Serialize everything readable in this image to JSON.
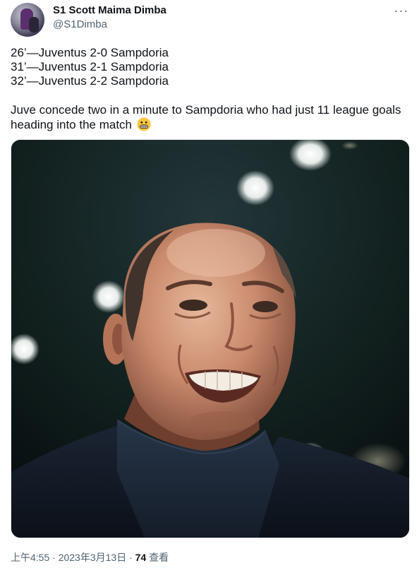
{
  "author": {
    "display_name": "S1 Scott Maima Dimba",
    "handle": "@S1Dimba",
    "avatar_icon": "avatar-photo"
  },
  "more_icon": "more-horizontal-icon",
  "tweet": {
    "lines": [
      "26’—Juventus 2-0 Sampdoria",
      "31’—Juventus 2-1 Sampdoria",
      "32’—Juventus 2-2 Sampdoria"
    ],
    "caption": "Juve concede two in a minute to Sampdoria who had just 11 league goals heading into the match",
    "emoji": "grimacing-face-emoji"
  },
  "media": {
    "subject": "photo-of-grimacing-man-in-dark-turtleneck"
  },
  "meta": {
    "time": "上午4:55",
    "separator": "·",
    "date": "2023年3月13日",
    "views_count": "74",
    "views_label": "查看"
  },
  "colors": {
    "text": "#0f1419",
    "secondary": "#536471",
    "border": "#e5e8ea"
  }
}
